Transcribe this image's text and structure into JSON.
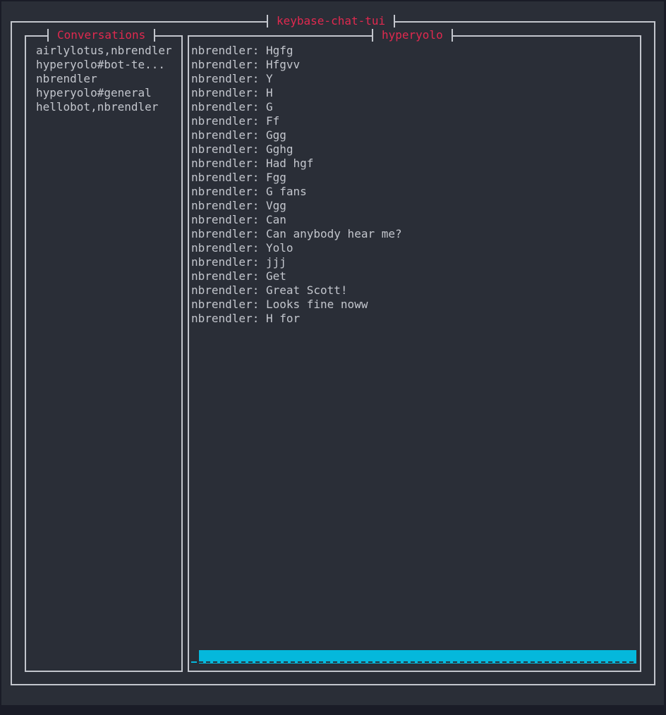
{
  "app": {
    "title": "keybase-chat-tui"
  },
  "conversations": {
    "title": "Conversations",
    "items": [
      {
        "label": "airlylotus,nbrendler"
      },
      {
        "label": "hyperyolo#bot-te..."
      },
      {
        "label": "nbrendler"
      },
      {
        "label": "hyperyolo#general"
      },
      {
        "label": "hellobot,nbrendler"
      }
    ]
  },
  "chat": {
    "title": "hyperyolo",
    "messages": [
      {
        "text": "nbrendler: Hgfg"
      },
      {
        "text": "nbrendler: Hfgvv"
      },
      {
        "text": "nbrendler: Y"
      },
      {
        "text": "nbrendler: H"
      },
      {
        "text": "nbrendler: G"
      },
      {
        "text": "nbrendler: Ff"
      },
      {
        "text": "nbrendler: Ggg"
      },
      {
        "text": "nbrendler: Gghg"
      },
      {
        "text": "nbrendler: Had hgf"
      },
      {
        "text": "nbrendler: Fgg"
      },
      {
        "text": "nbrendler: G fans"
      },
      {
        "text": "nbrendler: Vgg"
      },
      {
        "text": "nbrendler: Can"
      },
      {
        "text": "nbrendler: Can anybody hear me?"
      },
      {
        "text": "nbrendler: Yolo"
      },
      {
        "text": "nbrendler: jjj"
      },
      {
        "text": "nbrendler: Get"
      },
      {
        "text": "nbrendler: Great Scott!"
      },
      {
        "text": "nbrendler: Looks fine noww"
      },
      {
        "text": "nbrendler: H for"
      }
    ],
    "input": {
      "value": ""
    }
  },
  "colors": {
    "accent": "#e0294f",
    "input": "#05b8dc",
    "border": "#c3c6cd",
    "background": "#2a2e37"
  }
}
